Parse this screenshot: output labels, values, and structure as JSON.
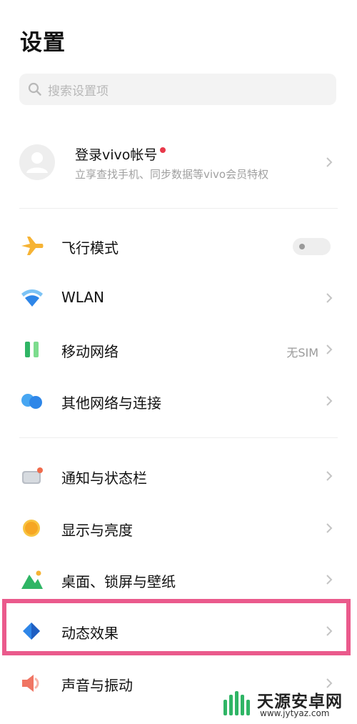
{
  "header": {
    "title": "设置"
  },
  "search": {
    "placeholder": "搜索设置项"
  },
  "account": {
    "title": "登录vivo帐号",
    "subtitle": "立享查找手机、同步数据等vivo会员特权"
  },
  "network_items": [
    {
      "label": "飞行模式",
      "icon": "airplane-icon",
      "control": "toggle",
      "toggle_on": false
    },
    {
      "label": "WLAN",
      "icon": "wifi-icon"
    },
    {
      "label": "移动网络",
      "icon": "mobile-network-icon",
      "value": "无SIM"
    },
    {
      "label": "其他网络与连接",
      "icon": "connection-icon"
    }
  ],
  "system_items": [
    {
      "label": "通知与状态栏",
      "icon": "notification-icon"
    },
    {
      "label": "显示与亮度",
      "icon": "brightness-icon"
    },
    {
      "label": "桌面、锁屏与壁纸",
      "icon": "wallpaper-icon"
    },
    {
      "label": "动态效果",
      "icon": "dynamic-effects-icon",
      "highlighted": true
    },
    {
      "label": "声音与振动",
      "icon": "sound-icon"
    }
  ],
  "watermark": {
    "name": "天源安卓网",
    "url": "www.jytyaz.com"
  },
  "colors": {
    "highlight": "#ea5a8c",
    "red_dot": "#e8394a",
    "airplane": "#f6b334",
    "wifi": "#2e86e8",
    "mobile": "#2fb565"
  }
}
